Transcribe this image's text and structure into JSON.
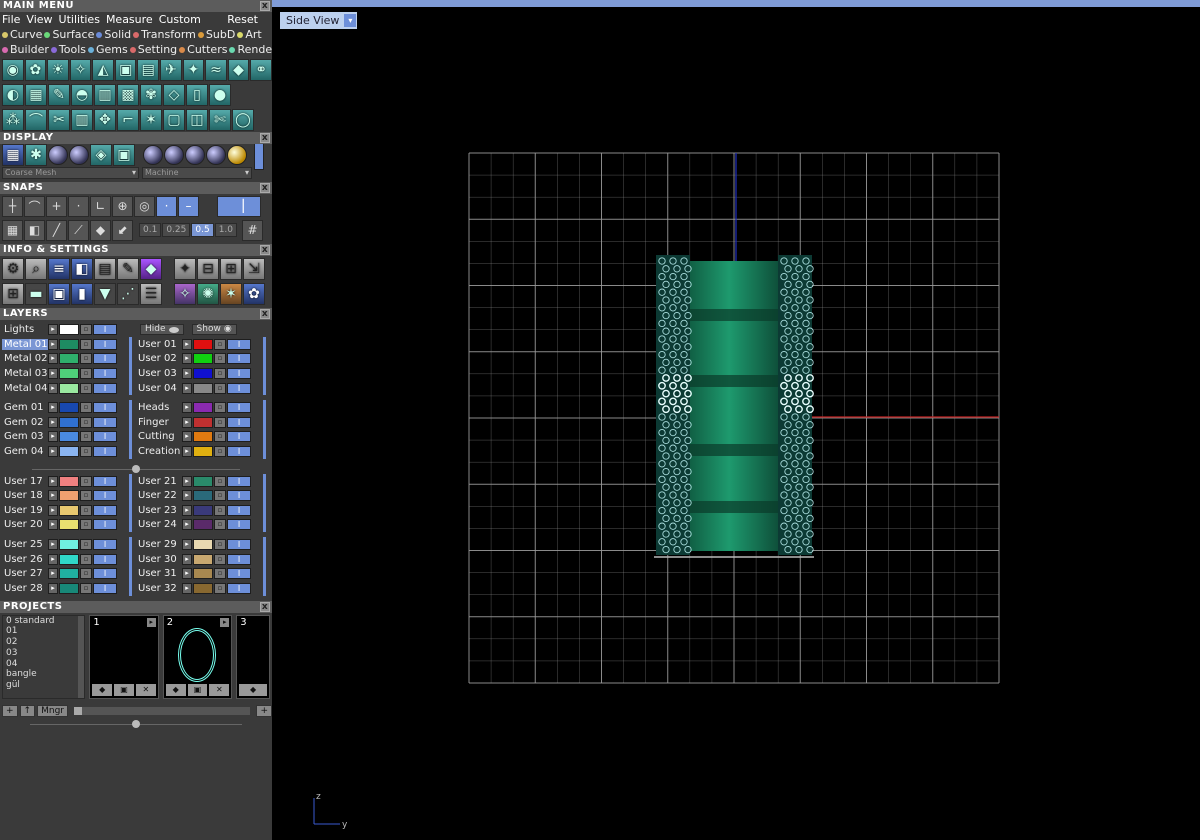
{
  "panel": {
    "main_menu": {
      "title": "MAIN MENU",
      "close": "x",
      "menus": [
        "File",
        "View",
        "Utilities",
        "Measure",
        "Custom"
      ],
      "reset": "Reset"
    },
    "categories_row1": [
      {
        "label": "Curve",
        "color": "#d9c86a"
      },
      {
        "label": "Surface",
        "color": "#6ad97a"
      },
      {
        "label": "Solid",
        "color": "#6a8bd9"
      },
      {
        "label": "Transform",
        "color": "#d96a6a"
      },
      {
        "label": "SubD",
        "color": "#d99a3a"
      },
      {
        "label": "Art",
        "color": "#d9d96a"
      }
    ],
    "categories_row2": [
      {
        "label": "Builder",
        "color": "#d96ab0"
      },
      {
        "label": "Tools",
        "color": "#8a6ad9"
      },
      {
        "label": "Gems",
        "color": "#6ab0d9"
      },
      {
        "label": "Setting",
        "color": "#d96a6a"
      },
      {
        "label": "Cutters",
        "color": "#d98a4a"
      },
      {
        "label": "Render",
        "color": "#6ad9b0"
      }
    ],
    "toolbar_icons": [
      [
        "globe-icon",
        "bulb-icon",
        "sun-icon",
        "lamp-icon",
        "cone-icon",
        "chip-icon",
        "hatch-icon",
        "bird-icon",
        "plane-icon",
        "wave-icon",
        "gem-icon",
        "rings-icon"
      ],
      [
        "paint-icon",
        "grid-icon",
        "brush-icon",
        "jar-icon",
        "page-icon",
        "pattern-icon",
        "tree-icon",
        "glass-icon",
        "mouse-icon",
        "sphere-icon"
      ],
      [
        "cluster-icon",
        "arc-icon",
        "cut-icon",
        "columns-icon",
        "move-icon",
        "corner-icon",
        "burst-icon",
        "frame-icon",
        "split-icon",
        "scissors-icon",
        "ring-icon"
      ]
    ],
    "display": {
      "title": "DISPLAY",
      "mesh": "Coarse Mesh",
      "material": "Machine"
    },
    "snaps": {
      "title": "SNAPS",
      "values": [
        "0.1",
        "0.25",
        "0.5",
        "1.0"
      ],
      "active_value": "0.5"
    },
    "info": {
      "title": "INFO & SETTINGS"
    },
    "layers": {
      "title": "LAYERS",
      "lights": "Lights",
      "hide": "Hide",
      "show": "Show",
      "groups": [
        {
          "left": [
            {
              "name": "Metal 01",
              "color": "#1e8c62",
              "selected": true
            },
            {
              "name": "Metal 02",
              "color": "#2fb06c"
            },
            {
              "name": "Metal 03",
              "color": "#4fd07a"
            },
            {
              "name": "Metal 04",
              "color": "#9ae8a0"
            }
          ],
          "right": [
            {
              "name": "User 01",
              "color": "#e01010"
            },
            {
              "name": "User 02",
              "color": "#10d010"
            },
            {
              "name": "User 03",
              "color": "#1010d0"
            },
            {
              "name": "User 04",
              "color": "#888888"
            }
          ]
        },
        {
          "left": [
            {
              "name": "Gem 01",
              "color": "#1848b0"
            },
            {
              "name": "Gem 02",
              "color": "#3070d0"
            },
            {
              "name": "Gem 03",
              "color": "#4a8ae0"
            },
            {
              "name": "Gem 04",
              "color": "#8ab4f0"
            }
          ],
          "right": [
            {
              "name": "Heads",
              "color": "#8a2ab0"
            },
            {
              "name": "Finger",
              "color": "#c03030"
            },
            {
              "name": "Cutting",
              "color": "#e07a10"
            },
            {
              "name": "Creation",
              "color": "#e0b010"
            }
          ]
        },
        {
          "left": [
            {
              "name": "User 17",
              "color": "#f08080"
            },
            {
              "name": "User 18",
              "color": "#f0a070"
            },
            {
              "name": "User 19",
              "color": "#e8c870"
            },
            {
              "name": "User 20",
              "color": "#e8e070"
            }
          ],
          "right": [
            {
              "name": "User 21",
              "color": "#2a8a6a"
            },
            {
              "name": "User 22",
              "color": "#2a6a7a"
            },
            {
              "name": "User 23",
              "color": "#3a3a7a"
            },
            {
              "name": "User 24",
              "color": "#5a2a6a"
            }
          ]
        },
        {
          "left": [
            {
              "name": "User 25",
              "color": "#70f0e0"
            },
            {
              "name": "User 26",
              "color": "#30d8c8"
            },
            {
              "name": "User 27",
              "color": "#20b0a0"
            },
            {
              "name": "User 28",
              "color": "#188878"
            }
          ],
          "right": [
            {
              "name": "User 29",
              "color": "#e8d8b0"
            },
            {
              "name": "User 30",
              "color": "#c8a870"
            },
            {
              "name": "User 31",
              "color": "#a88850"
            },
            {
              "name": "User 32",
              "color": "#886830"
            }
          ]
        }
      ]
    },
    "projects": {
      "title": "PROJECTS",
      "list": [
        "0 standard",
        "01",
        "02",
        "03",
        "04",
        "bangle",
        "gül"
      ],
      "slots": [
        "1",
        "2",
        "3"
      ],
      "manager": "Mngr"
    }
  },
  "viewport": {
    "view_name": "Side View",
    "axis_labels": {
      "vertical": "z",
      "horizontal": "y"
    },
    "colors": {
      "grid": "#9a9a9a",
      "model": "#1e9a6e",
      "gems": "#a8dcdc",
      "x_axis": "#c02020",
      "y_axis": "#2030c0",
      "accent": "#7f9bd6"
    }
  }
}
